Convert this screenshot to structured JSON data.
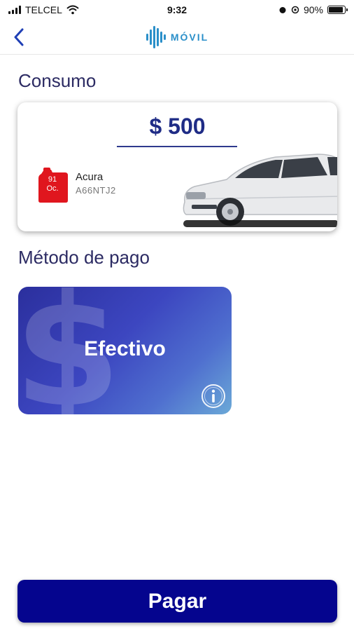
{
  "status_bar": {
    "carrier": "TELCEL",
    "time": "9:32",
    "battery": "90%",
    "battery_level": 0.9
  },
  "nav": {
    "logo_text": "MÓVIL",
    "back_icon": "chevron-left-icon"
  },
  "consumo": {
    "title": "Consumo",
    "amount": "$ 500",
    "fuel_octane": "91",
    "fuel_unit": "Oc.",
    "vehicle_name": "Acura",
    "vehicle_plate": "A66NTJ2"
  },
  "metodo": {
    "title": "Método de pago",
    "method_label": "Efectivo",
    "method_icon": "dollar-sign-icon",
    "info_icon": "info-icon"
  },
  "actions": {
    "pay_label": "Pagar"
  },
  "colors": {
    "title": "#2c2b63",
    "amount": "#1f2c86",
    "pay_button": "#05058e",
    "fuel_icon": "#e0161e",
    "logo": "#2a8fc9"
  }
}
